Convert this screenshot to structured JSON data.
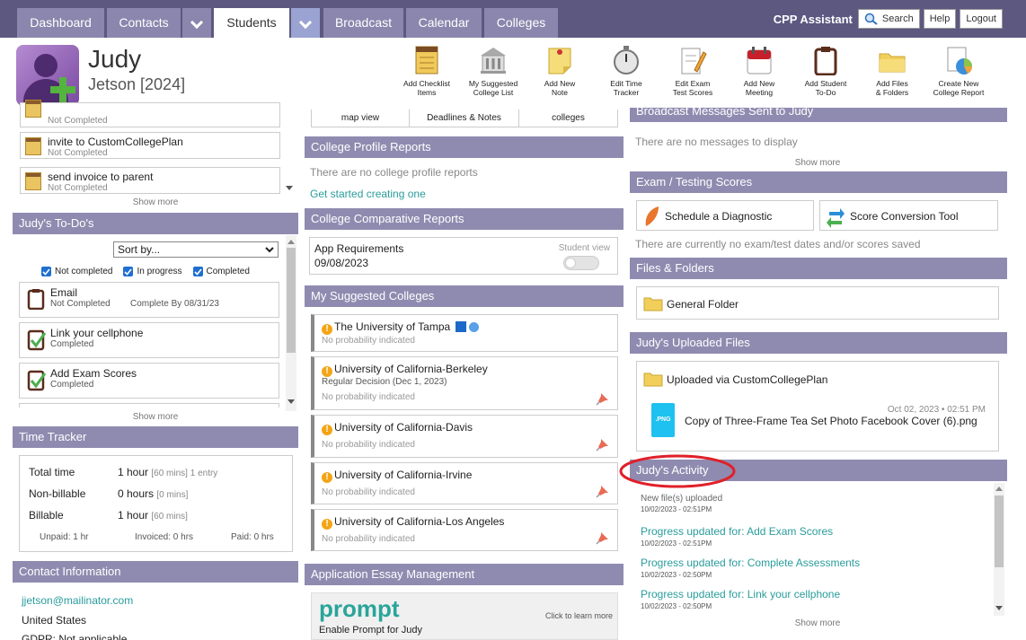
{
  "nav": {
    "tabs": [
      "Dashboard",
      "Contacts",
      "Students",
      "Broadcast",
      "Calendar",
      "Colleges"
    ],
    "assistant": "CPP Assistant",
    "search_label": "Search",
    "help_label": "Help",
    "logout_label": "Logout"
  },
  "student": {
    "first": "Judy",
    "last": "Jetson [2024]"
  },
  "tools": [
    "Add Checklist\nItems",
    "My Suggested\nCollege List",
    "Add New\nNote",
    "Edit Time\nTracker",
    "Edit Exam\nTest Scores",
    "Add New\nMeeting",
    "Add Student\nTo-Do",
    "Add Files\n& Folders",
    "Create New\nCollege Report"
  ],
  "checklist": {
    "items": [
      {
        "title": "",
        "status": "Not Completed"
      },
      {
        "title": "invite to CustomCollegePlan",
        "status": "Not Completed"
      },
      {
        "title": "send invoice to parent",
        "status": "Not Completed"
      }
    ],
    "show_more": "Show more"
  },
  "todo": {
    "title": "Judy's To-Do's",
    "sort_label": "Sort by...",
    "filters": [
      "Not completed",
      "In progress",
      "Completed"
    ],
    "items": [
      {
        "title": "Email",
        "status": "Not Completed",
        "due": "Complete By 08/31/23"
      },
      {
        "title": "Link your cellphone",
        "status": "Completed",
        "due": ""
      },
      {
        "title": "Add Exam Scores",
        "status": "Completed",
        "due": ""
      }
    ],
    "show_more": "Show more"
  },
  "time_tracker": {
    "title": "Time Tracker",
    "rows": [
      {
        "label": "Total time",
        "value": "1 hour",
        "detail": "[60 mins] 1 entry"
      },
      {
        "label": "Non-billable",
        "value": "0 hours",
        "detail": "[0 mins]"
      },
      {
        "label": "Billable",
        "value": "1 hour",
        "detail": "[60 mins]"
      }
    ],
    "unpaid": "Unpaid: 1 hr",
    "invoiced": "Invoiced: 0 hrs",
    "paid": "Paid: 0 hrs"
  },
  "contact": {
    "title": "Contact Information",
    "email": "jjetson@mailinator.com",
    "country": "United States",
    "gdpr": "GDPR: Not applicable"
  },
  "middle_tabs": [
    "map view",
    "Deadlines & Notes",
    "colleges"
  ],
  "profile_reports": {
    "title": "College Profile Reports",
    "empty": "There are no college profile reports",
    "cta": "Get started creating one"
  },
  "comparative": {
    "title": "College Comparative Reports",
    "report_name": "App Requirements",
    "report_date": "09/08/2023",
    "student_view": "Student view"
  },
  "suggested": {
    "title": "My Suggested Colleges",
    "colleges": [
      {
        "name": "The University of Tampa",
        "sub": "",
        "prob": "No probability indicated"
      },
      {
        "name": "University of California-Berkeley",
        "sub": "Regular Decision (Dec 1, 2023)",
        "prob": "No probability indicated"
      },
      {
        "name": "University of California-Davis",
        "sub": "",
        "prob": "No probability indicated"
      },
      {
        "name": "University of California-Irvine",
        "sub": "",
        "prob": "No probability indicated"
      },
      {
        "name": "University of California-Los Angeles",
        "sub": "",
        "prob": "No probability indicated"
      }
    ]
  },
  "essay": {
    "title": "Application Essay Management",
    "brand": "prompt",
    "enable": "Enable Prompt for Judy",
    "learn": "Click to learn more"
  },
  "broadcast": {
    "title": "Broadcast Messages Sent to Judy",
    "empty": "There are no messages to display",
    "show_more": "Show more"
  },
  "exam": {
    "title": "Exam / Testing Scores",
    "diag": "Schedule a Diagnostic",
    "conv": "Score Conversion Tool",
    "empty": "There are currently no exam/test dates and/or scores saved"
  },
  "files": {
    "title": "Files & Folders",
    "folder": "General Folder"
  },
  "uploaded": {
    "title": "Judy's Uploaded Files",
    "folder": "Uploaded via CustomCollegePlan",
    "date": "Oct 02, 2023 • 02:51 PM",
    "file_badge": ".PNG",
    "file_name": "Copy of Three-Frame Tea Set Photo Facebook Cover (6).png"
  },
  "activity": {
    "title": "Judy's Activity",
    "items": [
      {
        "text": "New file(s) uploaded",
        "date": "10/02/2023 - 02:51PM",
        "link": false
      },
      {
        "text": "Progress updated for: Add Exam Scores",
        "date": "10/02/2023 - 02:51PM",
        "link": true
      },
      {
        "text": "Progress updated for: Complete Assessments",
        "date": "10/02/2023 - 02:50PM",
        "link": true
      },
      {
        "text": "Progress updated for: Link your cellphone",
        "date": "10/02/2023 - 02:50PM",
        "link": true
      }
    ],
    "show_more": "Show more"
  }
}
